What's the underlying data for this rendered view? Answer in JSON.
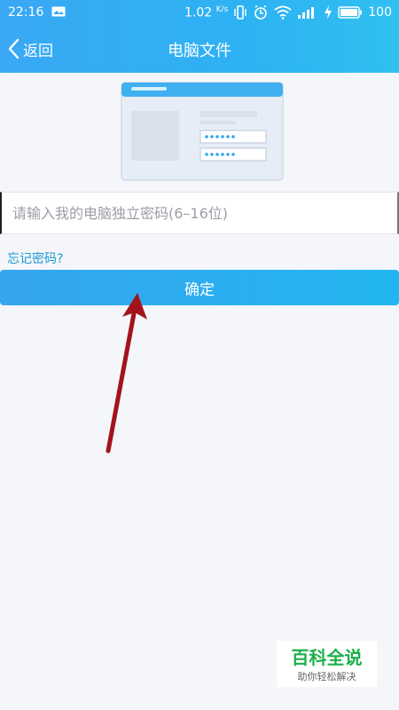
{
  "status_bar": {
    "time": "22:16",
    "net_speed": "1.02",
    "net_unit": "K/s",
    "battery": "100"
  },
  "header": {
    "back_label": "返回",
    "title": "电脑文件"
  },
  "form": {
    "password_placeholder": "请输入我的电脑独立密码(6–16位)",
    "password_value": "",
    "forgot_label": "忘记密码?",
    "confirm_label": "确定"
  },
  "watermark": {
    "title": "百科全说",
    "subtitle": "助你轻松解决"
  },
  "colors": {
    "header": "#2eb2f3",
    "link": "#1a9bd6",
    "annotation_arrow": "#a3131c"
  }
}
